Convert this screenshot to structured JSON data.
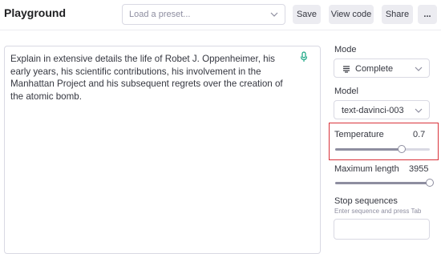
{
  "header": {
    "title": "Playground",
    "preset_placeholder": "Load a preset...",
    "save_label": "Save",
    "view_code_label": "View code",
    "share_label": "Share",
    "more_label": "..."
  },
  "editor": {
    "prompt": "Explain in extensive details the life of Robet J. Oppenheimer, his early years, his scientific contributions, his involvement in the Manhattan Project and his subsequent regrets over the creation of the atomic bomb."
  },
  "sidebar": {
    "mode_label": "Mode",
    "mode_value": "Complete",
    "model_label": "Model",
    "model_value": "text-davinci-003",
    "temperature_label": "Temperature",
    "temperature_value": "0.7",
    "temperature_fraction": 0.7,
    "max_length_label": "Maximum length",
    "max_length_value": "3955",
    "max_length_fraction": 1.0,
    "stop_label": "Stop sequences",
    "stop_hint": "Enter sequence and press Tab"
  },
  "colors": {
    "accent_gray": "#8e8ea0",
    "highlight_red": "#d9323a",
    "mic_green": "#10a37f"
  }
}
